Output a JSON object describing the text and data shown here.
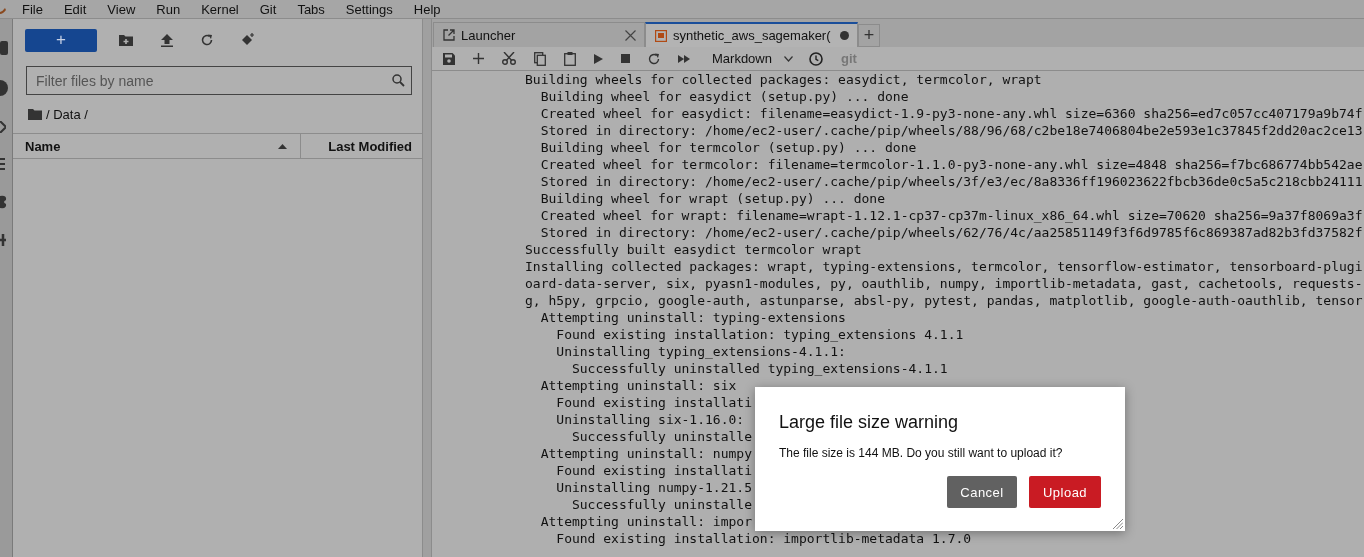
{
  "menu": [
    "File",
    "Edit",
    "View",
    "Run",
    "Kernel",
    "Git",
    "Tabs",
    "Settings",
    "Help"
  ],
  "file_browser": {
    "new_button": "+",
    "filter": {
      "placeholder": "Filter files by name"
    },
    "breadcrumb": "/ Data /",
    "columns": [
      {
        "label": "Name",
        "sorted": true
      },
      {
        "label": "Last Modified",
        "sorted": false
      }
    ]
  },
  "tabs": [
    {
      "label": "Launcher",
      "kind": "launcher",
      "selected": false,
      "modified": false
    },
    {
      "label": "synthetic_aws_sagemaker(",
      "kind": "notebook",
      "selected": true,
      "modified": true
    }
  ],
  "add_tab": "+",
  "notebook_toolbar": {
    "cell_type": "Markdown",
    "git": "git"
  },
  "output_lines": [
    "Building wheels for collected packages: easydict, termcolor, wrapt",
    "  Building wheel for easydict (setup.py) ... done",
    "  Created wheel for easydict: filename=easydict-1.9-py3-none-any.whl size=6360 sha256=ed7c057cc407179a9b74f",
    "  Stored in directory: /home/ec2-user/.cache/pip/wheels/88/96/68/c2be18e7406804be2e593e1c37845f2dd20ac2ce13",
    "  Building wheel for termcolor (setup.py) ... done",
    "  Created wheel for termcolor: filename=termcolor-1.1.0-py3-none-any.whl size=4848 sha256=f7bc686774bb542ae",
    "  Stored in directory: /home/ec2-user/.cache/pip/wheels/3f/e3/ec/8a8336ff196023622fbcb36de0c5a5c218cbb24111",
    "  Building wheel for wrapt (setup.py) ... done",
    "  Created wheel for wrapt: filename=wrapt-1.12.1-cp37-cp37m-linux_x86_64.whl size=70620 sha256=9a37f8069a3f",
    "  Stored in directory: /home/ec2-user/.cache/pip/wheels/62/76/4c/aa25851149f3f6d9785f6c869387ad82b3fd37582f",
    "Successfully built easydict termcolor wrapt",
    "Installing collected packages: wrapt, typing-extensions, termcolor, tensorflow-estimator, tensorboard-plugi",
    "oard-data-server, six, pyasn1-modules, py, oauthlib, numpy, importlib-metadata, gast, cachetools, requests-",
    "g, h5py, grpcio, google-auth, astunparse, absl-py, pytest, pandas, matplotlib, google-auth-oauthlib, tensor",
    "  Attempting uninstall: typing-extensions",
    "    Found existing installation: typing_extensions 4.1.1",
    "    Uninstalling typing_extensions-4.1.1:",
    "      Successfully uninstalled typing_extensions-4.1.1",
    "  Attempting uninstall: six",
    "    Found existing installati",
    "    Uninstalling six-1.16.0:",
    "      Successfully uninstalle",
    "  Attempting uninstall: numpy",
    "    Found existing installati",
    "    Uninstalling numpy-1.21.5",
    "      Successfully uninstalle",
    "  Attempting uninstall: impor",
    "    Found existing installation: importlib-metadata 1.7.0"
  ],
  "dialog": {
    "title": "Large file size warning",
    "message": "The file size is 144 MB. Do you still want to upload it?",
    "buttons": [
      {
        "label": "Cancel",
        "kind": "secondary"
      },
      {
        "label": "Upload",
        "kind": "danger"
      }
    ]
  }
}
